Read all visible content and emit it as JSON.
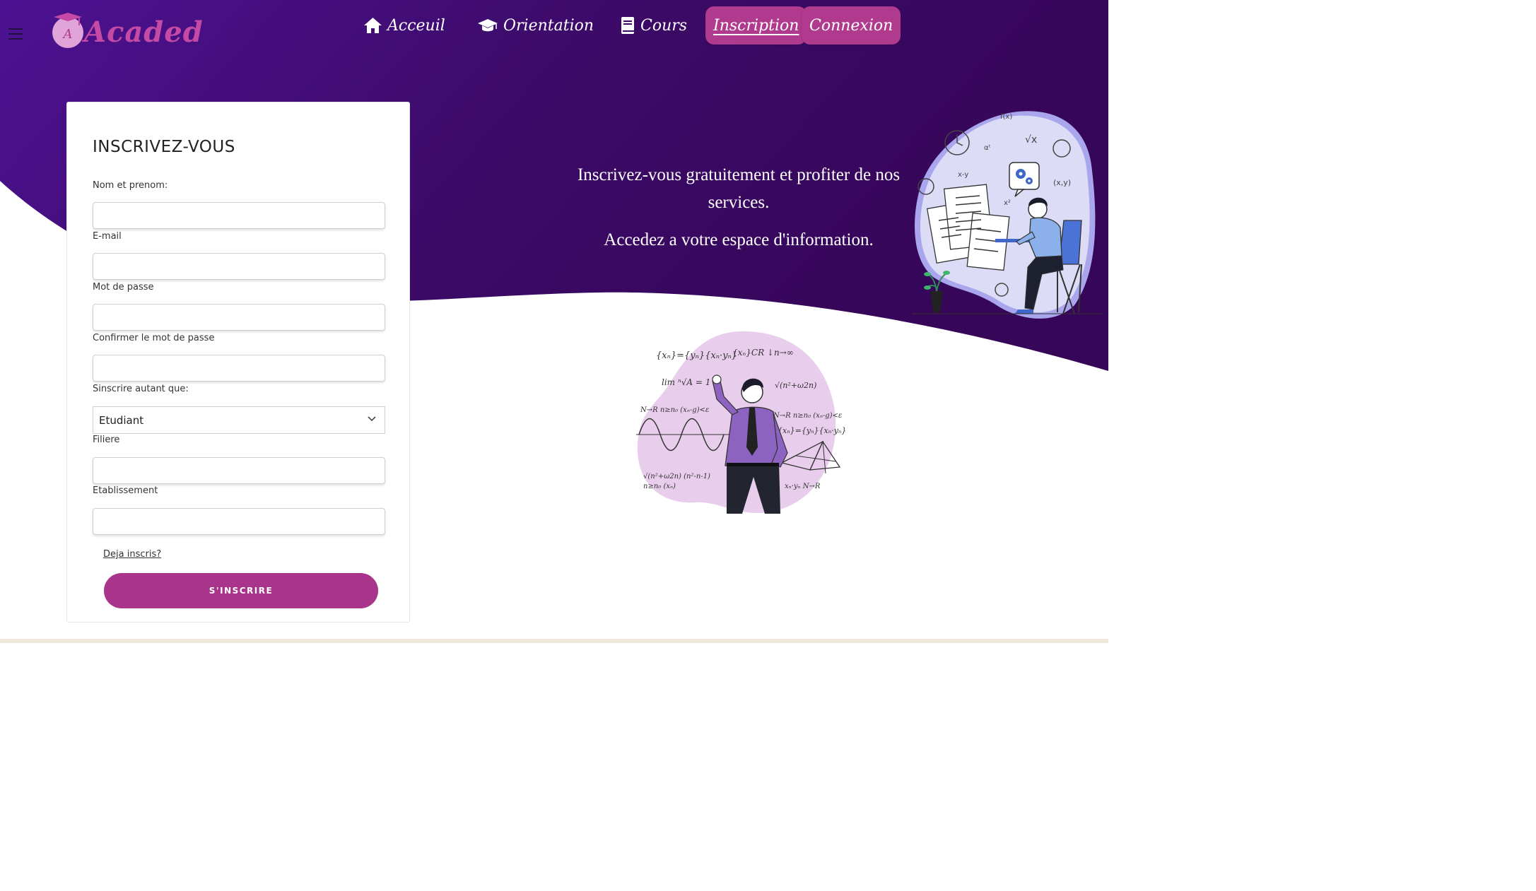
{
  "header": {
    "logo_text": "Acaded",
    "logo_letter": "A",
    "nav": [
      {
        "label": "Acceuil",
        "icon": "home-icon"
      },
      {
        "label": "Orientation",
        "icon": "graduation-cap-icon"
      },
      {
        "label": "Cours",
        "icon": "book-icon"
      },
      {
        "label": "Inscription",
        "active": true
      },
      {
        "label": "Connexion"
      }
    ]
  },
  "form": {
    "title": "INSCRIVEZ-VOUS",
    "fields": {
      "name": {
        "label": "Nom et prenom:",
        "value": ""
      },
      "email": {
        "label": "E-mail",
        "value": ""
      },
      "password": {
        "label": "Mot de passe",
        "value": ""
      },
      "confirm": {
        "label": "Confirmer le mot de passe",
        "value": ""
      },
      "role": {
        "label": "Sinscrire autant que:",
        "value": "Etudiant"
      },
      "filiere": {
        "label": "Filiere",
        "value": ""
      },
      "etablissement": {
        "label": "Etablissement",
        "value": ""
      }
    },
    "login_link": "Deja inscris?",
    "submit_label": "S'INSCRIRE"
  },
  "hero": {
    "line1": "Inscrivez-vous gratuitement et profiter de nos services.",
    "line2": "Accedez a votre espace d'information."
  },
  "colors": {
    "hero_dark": "#3a0860",
    "hero_light": "#4f1395",
    "accent": "#a8358b",
    "logo": "#c44aa6",
    "blob_lavender": "#dcdcf7",
    "blob_pink": "#e8cdec"
  }
}
